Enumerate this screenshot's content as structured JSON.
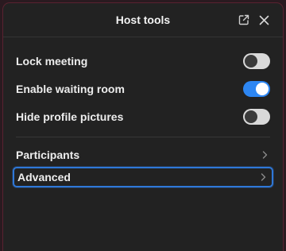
{
  "header": {
    "title": "Host tools",
    "icons": {
      "popout": "popout-icon",
      "close": "close-icon"
    }
  },
  "settings": [
    {
      "label": "Lock meeting",
      "enabled": false
    },
    {
      "label": "Enable waiting room",
      "enabled": true
    },
    {
      "label": "Hide profile pictures",
      "enabled": false
    }
  ],
  "nav": [
    {
      "label": "Participants",
      "focused": false
    },
    {
      "label": "Advanced",
      "focused": true
    }
  ],
  "colors": {
    "toggle_on": "#2d86f2",
    "toggle_off": "#d9d9d9",
    "focus_ring": "#2f78d8",
    "panel_bg": "#222222"
  }
}
